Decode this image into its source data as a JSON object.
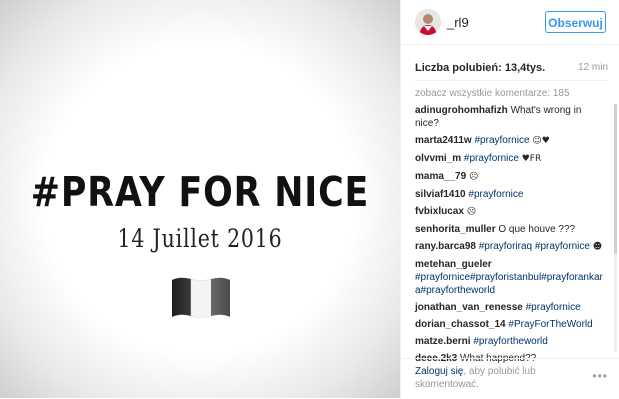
{
  "image": {
    "hashtag": "#PRAY FOR NICE",
    "date": "14 Juillet 2016",
    "flag_icon": "france-flag-icon"
  },
  "header": {
    "username": "_rl9",
    "follow_label": "Obserwuj"
  },
  "likes": {
    "label": "Liczba polubień: 13,4tys.",
    "time": "12 min"
  },
  "view_all": "zobacz wszystkie komentarze: 185",
  "comments": [
    {
      "user": "adinugrohomhafizh",
      "text": "What's wrong in nice?"
    },
    {
      "user": "marta2411w",
      "text": "",
      "tags": "#prayfornice",
      "suffix": "☺♥"
    },
    {
      "user": "olvvmi_m",
      "text": "",
      "tags": "#prayfornice",
      "suffix": "♥FR"
    },
    {
      "user": "mama__79",
      "text": "",
      "suffix": "☹"
    },
    {
      "user": "silviaf1410",
      "text": "",
      "tags": "#prayfornice"
    },
    {
      "user": "fvbixlucax",
      "text": "",
      "suffix": "☹"
    },
    {
      "user": "senhorita_muller",
      "text": "O que houve ???"
    },
    {
      "user": "rany.barca98",
      "text": "",
      "tags": "#prayforiraq #prayfornice",
      "suffix": "☻"
    },
    {
      "user": "metehan_gueler",
      "text": "",
      "tags": "#prayfornice#prayforistanbul#prayforankara#prayfortheworld"
    },
    {
      "user": "jonathan_van_renesse",
      "text": "",
      "tags": "#prayfornice"
    },
    {
      "user": "dorian_chassot_14",
      "text": "",
      "tags": "#PrayForTheWorld"
    },
    {
      "user": "matze.berni",
      "text": "",
      "tags": "#prayfortheworld"
    },
    {
      "user": "deee.2k3",
      "text": "What happend??"
    }
  ],
  "footer": {
    "login_link": "Zaloguj się",
    "login_rest": ", aby polubić lub skomentować.",
    "more": "•••"
  }
}
